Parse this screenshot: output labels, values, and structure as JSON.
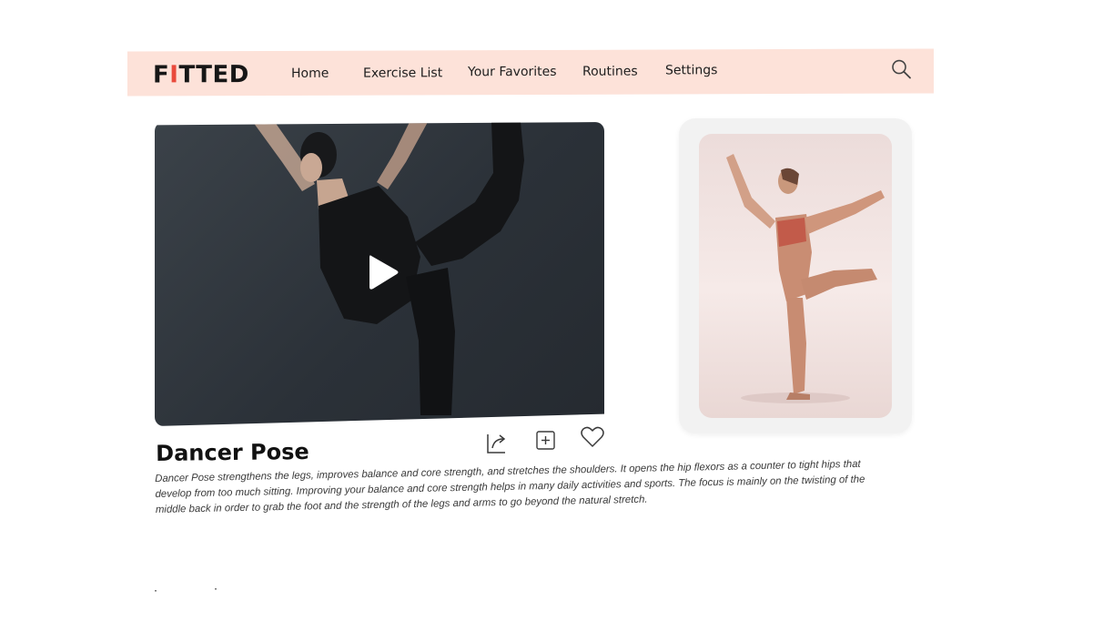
{
  "brand": {
    "logo_prefix": "F",
    "logo_accent": "I",
    "logo_suffix": "TTED"
  },
  "nav": {
    "home": "Home",
    "exercise_list": "Exercise List",
    "favorites": "Your Favorites",
    "routines": "Routines",
    "settings": "Settings"
  },
  "exercise": {
    "title": "Dancer Pose",
    "description": "Dancer Pose strengthens the legs, improves balance and core strength, and stretches the shoulders. It opens the hip flexors as a counter to tight hips that develop from too much sitting. Improving your balance and core strength helps in many daily activities and sports. The focus is mainly on the twisting of the middle back in order to grab the foot and the strength of the legs and arms to go beyond the natural stretch."
  },
  "icons": {
    "search": "search-icon",
    "play": "play-icon",
    "share": "share-icon",
    "add": "add-icon",
    "favorite": "heart-icon"
  },
  "colors": {
    "nav_background": "#fde2d9",
    "logo_accent": "#e94a3c",
    "video_background": "#2f353c",
    "card_background": "#f2f2f2"
  }
}
